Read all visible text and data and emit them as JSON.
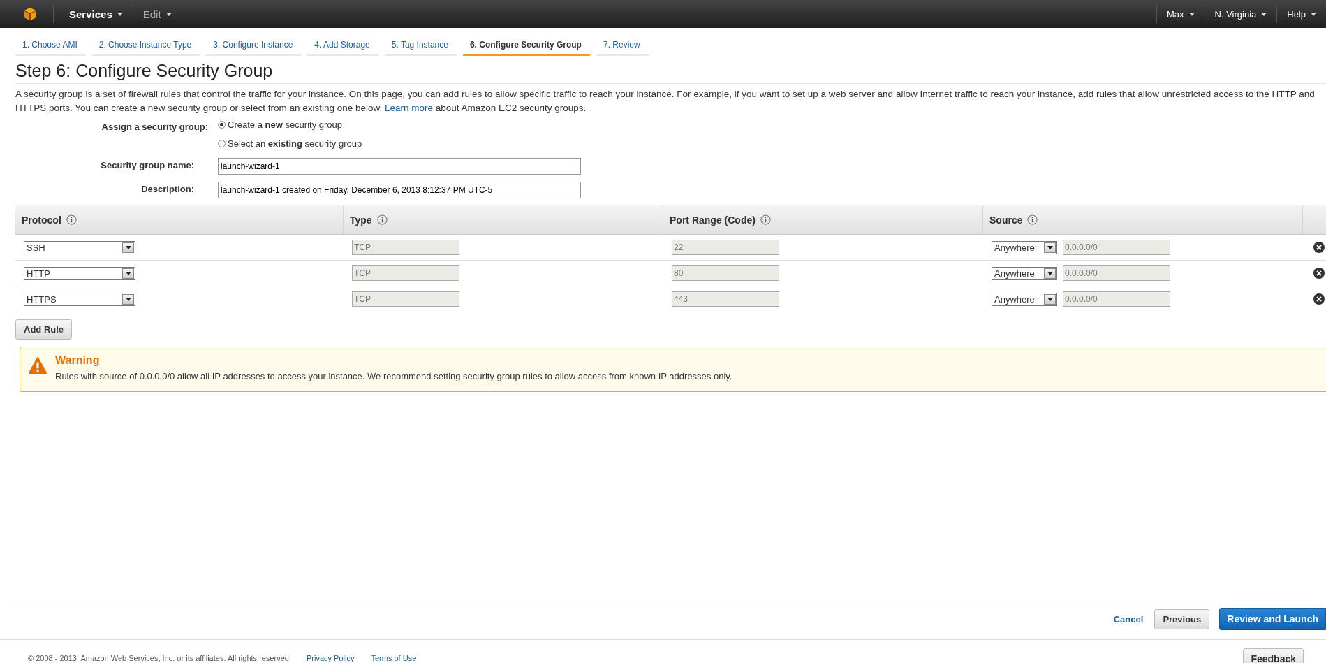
{
  "top_bar": {
    "menus": [
      {
        "label": "Services",
        "kind": "strong"
      },
      {
        "label": "Edit",
        "kind": "muted"
      }
    ],
    "right_menus": [
      "Max",
      "N. Virginia",
      "Help"
    ]
  },
  "steps": [
    {
      "label": "1. Choose AMI",
      "selected": false
    },
    {
      "label": "2. Choose Instance Type",
      "selected": false
    },
    {
      "label": "3. Configure Instance",
      "selected": false
    },
    {
      "label": "4. Add Storage",
      "selected": false
    },
    {
      "label": "5. Tag Instance",
      "selected": false
    },
    {
      "label": "6. Configure Security Group",
      "selected": true
    },
    {
      "label": "7. Review",
      "selected": false
    }
  ],
  "title": "Step 6: Configure Security Group",
  "intro": {
    "text": "A security group is a set of firewall rules that control the traffic for your instance. On this page, you can add rules to allow specific traffic to reach your instance. For example, if you want to set up a web server and allow Internet traffic to reach your instance, add rules that allow unrestricted access to the HTTP and HTTPS ports. You can create a new security group or select from an existing one below.",
    "link": "Learn more",
    "after": "about Amazon EC2 security groups."
  },
  "assign": {
    "label": "Assign a security group:",
    "options": [
      {
        "label": "Create a **new** security group",
        "selected": true
      },
      {
        "label": "Select an **existing** security group",
        "selected": false
      }
    ]
  },
  "fields": [
    {
      "label": "Security group name:",
      "value": "launch-wizard-1"
    },
    {
      "label": "Description:",
      "value": "launch-wizard-1 created on Friday, December 6, 2013 8:12:37 PM UTC-5"
    }
  ],
  "table": {
    "columns": [
      "Protocol",
      "Type",
      "Port Range (Code)",
      "Source"
    ],
    "rows": [
      {
        "protocol": "SSH",
        "type": "TCP",
        "port": "22",
        "source": "Anywhere",
        "cidr": "0.0.0.0/0"
      },
      {
        "protocol": "HTTP",
        "type": "TCP",
        "port": "80",
        "source": "Anywhere",
        "cidr": "0.0.0.0/0"
      },
      {
        "protocol": "HTTPS",
        "type": "TCP",
        "port": "443",
        "source": "Anywhere",
        "cidr": "0.0.0.0/0"
      }
    ]
  },
  "add_rule": "Add Rule",
  "warning": {
    "title": "Warning",
    "text": "Rules with source of 0.0.0.0/0 allow all IP addresses to access your instance. We recommend setting security group rules to allow access from known IP addresses only."
  },
  "actions": {
    "cancel": "Cancel",
    "previous": "Previous",
    "primary": "Review and Launch"
  },
  "footer": {
    "copyright": "© 2008 - 2013, Amazon Web Services, Inc. or its affiliates. All rights reserved.",
    "links": [
      "Privacy Policy",
      "Terms of Use"
    ],
    "feedback": "Feedback"
  }
}
